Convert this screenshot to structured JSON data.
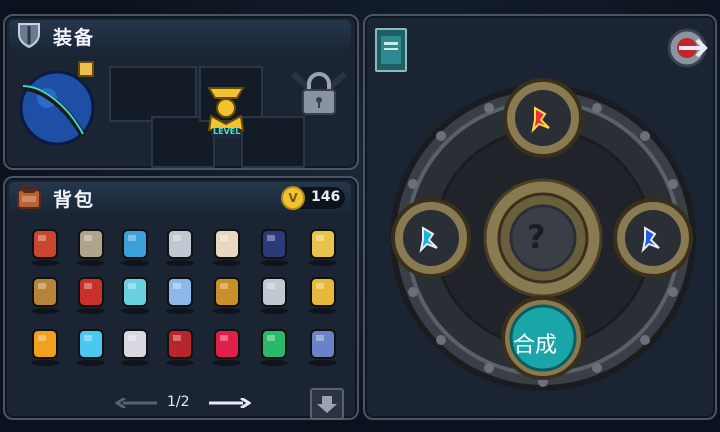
{
  "equipment": {
    "title": "装备",
    "slots": [
      {
        "name": "blue-staff",
        "icon": "blue-orb-staff-icon"
      },
      {
        "name": "empty"
      },
      {
        "name": "empty"
      },
      {
        "name": "gold-level-relic",
        "icon": "gold-relic-icon",
        "badge": "LEVEL"
      },
      {
        "name": "empty"
      },
      {
        "name": "locked",
        "icon": "lock-icon"
      }
    ]
  },
  "bag": {
    "title": "背包",
    "coins": "146",
    "page": "1/2",
    "items": [
      "red-card-icon",
      "robot-card-icon",
      "gold-ring-icon",
      "hammer-icon",
      "claw-icon",
      "bomb-icon",
      "wand-icon",
      "goggles-icon",
      "samurai-mask-icon",
      "potion-bottle-icon",
      "crystal-ball-icon",
      "scorpion-icon",
      "bead-necklace-icon",
      "gold-totem-icon",
      "fire-amulet-icon",
      "blue-flame-icon",
      "broken-dice-icon",
      "red-book-icon",
      "red-orb-icon",
      "green-ring-icon",
      "wolf-head-icon"
    ]
  },
  "crafting": {
    "center": "?",
    "button": "合成"
  },
  "colors": {
    "accent": "#1aa5a8",
    "gold": "#f1c232"
  }
}
